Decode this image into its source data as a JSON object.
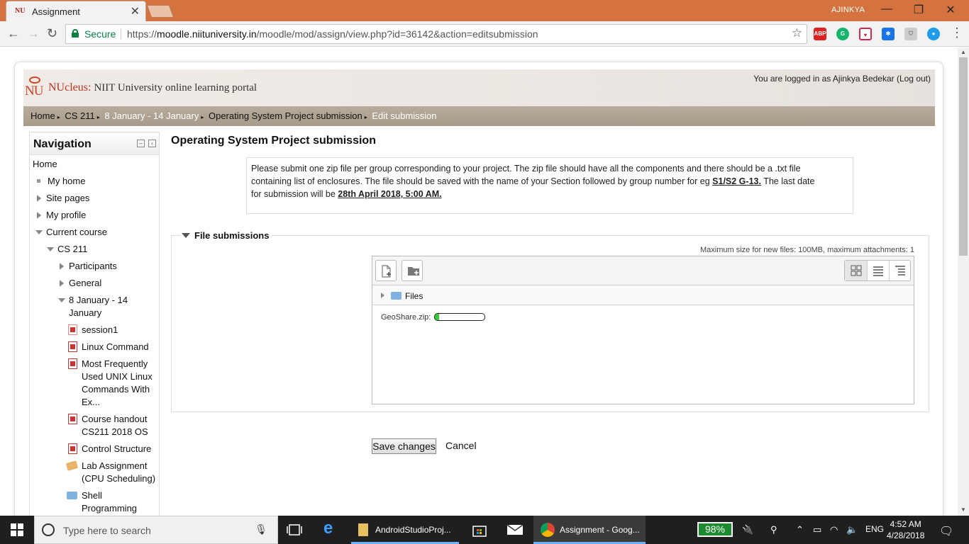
{
  "browser": {
    "tab_title": "Assignment",
    "tab_favicon_text": "NU",
    "profile_name": "AJINKYA",
    "secure_label": "Secure",
    "url_prefix": "https://",
    "url_host": "moodle.niituniversity.in",
    "url_path": "/moodle/mod/assign/view.php?id=36142&action=editsubmission",
    "extensions": [
      "adblock-icon",
      "grammarly-icon",
      "pocket-icon",
      "snowflake-icon",
      "shield-icon",
      "ext-circle-icon"
    ]
  },
  "site": {
    "logo_text": "NU",
    "title_brand": "NUcleus:",
    "title_rest": "NIIT University online learning portal",
    "login_text": "You are logged in as Ajinkya Bedekar (Log out)",
    "colors": {
      "brand_red": "#b32222",
      "breadcrumb_bg": "#aea393"
    }
  },
  "breadcrumb": [
    {
      "label": "Home"
    },
    {
      "label": "CS 211"
    },
    {
      "label": "8 January - 14 January"
    },
    {
      "label": "Operating System Project submission"
    },
    {
      "label": "Edit submission"
    }
  ],
  "navigation": {
    "title": "Navigation",
    "items": [
      {
        "label": "Home"
      },
      {
        "label": "My home"
      },
      {
        "label": "Site pages"
      },
      {
        "label": "My profile"
      },
      {
        "label": "Current course"
      },
      {
        "label": "CS 211"
      },
      {
        "label": "Participants"
      },
      {
        "label": "General"
      },
      {
        "label": "8 January - 14",
        "label2": "January"
      },
      {
        "label": "session1"
      },
      {
        "label": "Linux Command"
      },
      {
        "label": "Most Frequently",
        "label2": "Used UNIX Linux",
        "label3": "Commands With",
        "label4": "Ex..."
      },
      {
        "label": "Course handout",
        "label2": "CS211 2018 OS"
      },
      {
        "label": "Control Structure"
      },
      {
        "label": "Lab Assignment",
        "label2": "(CPU Scheduling)"
      },
      {
        "label": "Shell",
        "label2": "Programming"
      }
    ]
  },
  "main": {
    "heading": "Operating System Project submission",
    "intro_line1": "Please submit one zip file per group corresponding to your project.  The zip file should have all the components and there should be a .txt file",
    "intro_line2a": "containing list of enclosures. The file should be saved with the name of your Section followed by group number for eg ",
    "intro_example": "S1/S2 G-13.",
    "intro_line2b": " The last date",
    "intro_line3a": "for submission will be ",
    "intro_deadline": "28th April 2018, 5:00 AM.",
    "fieldset_legend": "File submissions",
    "max_size": "Maximum size for new files: 100MB, maximum attachments: 1",
    "folder_label": "Files",
    "upload_filename": "GeoShare.zip:",
    "upload_progress": 0.08,
    "save_button": "Save changes",
    "cancel_button": "Cancel"
  },
  "taskbar": {
    "search_placeholder": "Type here to search",
    "apps": [
      {
        "label": "AndroidStudioProj..."
      },
      {
        "label": "Assignment - Goog..."
      }
    ],
    "battery": "98%",
    "language": "ENG",
    "time": "4:52 AM",
    "date": "4/28/2018"
  }
}
